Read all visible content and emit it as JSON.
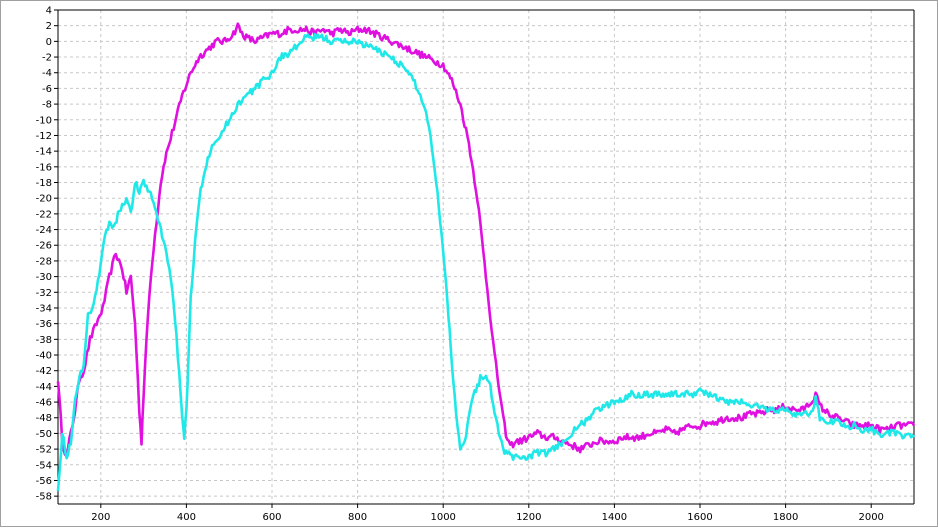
{
  "chart_data": {
    "type": "line",
    "title": "",
    "xlabel": "",
    "ylabel": "",
    "xlim": [
      100,
      2100
    ],
    "ylim": [
      -59,
      4
    ],
    "grid": true,
    "legend": "none",
    "x_ticks": [
      200,
      400,
      600,
      800,
      1000,
      1200,
      1400,
      1600,
      1800,
      2000
    ],
    "y_ticks": [
      4,
      2,
      0,
      -2,
      -4,
      -6,
      -8,
      -10,
      -12,
      -14,
      -16,
      -18,
      -20,
      -22,
      -24,
      -26,
      -28,
      -30,
      -32,
      -34,
      -36,
      -38,
      -40,
      -42,
      -44,
      -46,
      -48,
      -50,
      -52,
      -54,
      -56,
      -58
    ],
    "series": [
      {
        "color": "#e010e0",
        "x": [
          100,
          110,
          120,
          130,
          140,
          150,
          160,
          175,
          190,
          205,
          220,
          235,
          250,
          260,
          270,
          280,
          290,
          295,
          300,
          310,
          320,
          330,
          340,
          350,
          370,
          390,
          410,
          430,
          450,
          470,
          490,
          510,
          520,
          530,
          540,
          560,
          580,
          600,
          620,
          640,
          660,
          680,
          700,
          720,
          740,
          760,
          780,
          800,
          820,
          840,
          860,
          880,
          900,
          920,
          940,
          960,
          980,
          1000,
          1020,
          1040,
          1060,
          1080,
          1100,
          1120,
          1140,
          1150,
          1160,
          1170,
          1180,
          1200,
          1220,
          1240,
          1260,
          1280,
          1300,
          1320,
          1340,
          1360,
          1380,
          1400,
          1420,
          1440,
          1460,
          1480,
          1500,
          1520,
          1540,
          1560,
          1580,
          1600,
          1620,
          1640,
          1660,
          1680,
          1700,
          1720,
          1740,
          1760,
          1780,
          1800,
          1820,
          1840,
          1860,
          1870,
          1880,
          1900,
          1920,
          1940,
          1960,
          1980,
          2000,
          2020,
          2040,
          2060,
          2080,
          2100
        ],
        "values": [
          -43,
          -51,
          -53,
          -50,
          -47,
          -43,
          -42,
          -38,
          -36,
          -34,
          -30,
          -27,
          -29,
          -32,
          -30,
          -36,
          -47,
          -51,
          -45,
          -35,
          -28,
          -23,
          -18,
          -15,
          -11,
          -7,
          -4,
          -2,
          -1,
          0,
          0,
          1,
          2,
          1,
          0.5,
          0,
          0.5,
          1,
          1,
          1.5,
          1.5,
          1.5,
          1,
          1.5,
          1,
          1.5,
          1,
          1.5,
          1.5,
          1,
          0.5,
          0,
          -0.5,
          -1,
          -1.5,
          -2,
          -2.5,
          -3,
          -5,
          -8,
          -13,
          -20,
          -30,
          -40,
          -48,
          -51,
          -51.5,
          -51,
          -51,
          -50.5,
          -50,
          -50.5,
          -50.5,
          -51,
          -51.5,
          -52,
          -51.5,
          -51,
          -51,
          -51,
          -50.5,
          -50.5,
          -50.5,
          -50,
          -50,
          -49.5,
          -50,
          -49.5,
          -49,
          -49,
          -48.5,
          -48.5,
          -48,
          -48,
          -48,
          -47.5,
          -47.5,
          -47,
          -47,
          -46.5,
          -47,
          -47,
          -46,
          -45,
          -46.5,
          -47.5,
          -48,
          -48.5,
          -49,
          -49,
          -49,
          -49.5,
          -49.5,
          -49,
          -49,
          -49
        ]
      },
      {
        "color": "#20e8e8",
        "x": [
          100,
          110,
          120,
          130,
          140,
          150,
          160,
          170,
          180,
          190,
          200,
          210,
          220,
          230,
          240,
          250,
          260,
          270,
          280,
          290,
          300,
          310,
          320,
          330,
          340,
          350,
          360,
          370,
          380,
          390,
          395,
          400,
          405,
          410,
          420,
          430,
          440,
          450,
          460,
          480,
          500,
          520,
          540,
          560,
          580,
          600,
          620,
          640,
          660,
          680,
          700,
          720,
          740,
          760,
          780,
          800,
          820,
          840,
          860,
          880,
          900,
          920,
          940,
          960,
          970,
          980,
          990,
          1000,
          1010,
          1015,
          1020,
          1030,
          1040,
          1050,
          1060,
          1070,
          1080,
          1090,
          1100,
          1110,
          1120,
          1130,
          1140,
          1160,
          1180,
          1200,
          1220,
          1240,
          1260,
          1280,
          1300,
          1320,
          1340,
          1360,
          1380,
          1400,
          1420,
          1440,
          1460,
          1480,
          1500,
          1520,
          1540,
          1560,
          1580,
          1600,
          1620,
          1640,
          1660,
          1680,
          1700,
          1720,
          1740,
          1760,
          1780,
          1800,
          1820,
          1840,
          1860,
          1870,
          1880,
          1900,
          1920,
          1940,
          1960,
          1980,
          2000,
          2020,
          2040,
          2060,
          2080,
          2100
        ],
        "values": [
          -57,
          -50,
          -53,
          -51,
          -46,
          -43,
          -41,
          -35,
          -34,
          -32,
          -28,
          -25,
          -23,
          -24,
          -22,
          -21,
          -20,
          -22,
          -18,
          -19,
          -18,
          -19,
          -20,
          -22,
          -24,
          -26,
          -29,
          -33,
          -40,
          -48,
          -51,
          -47,
          -40,
          -33,
          -26,
          -20,
          -17,
          -15,
          -13,
          -12,
          -10,
          -8,
          -7,
          -6,
          -5,
          -4,
          -2,
          -1.5,
          -0.5,
          0.5,
          0.5,
          0.5,
          0,
          0,
          0,
          0,
          -0.5,
          -1,
          -1.5,
          -2,
          -3,
          -4,
          -6,
          -9,
          -12,
          -16,
          -21,
          -27,
          -33,
          -37,
          -41,
          -47,
          -52,
          -51,
          -48,
          -45,
          -44,
          -42.5,
          -43,
          -44,
          -47,
          -50,
          -52,
          -53,
          -53,
          -53,
          -52.5,
          -52.5,
          -52,
          -51,
          -50,
          -49,
          -48,
          -47,
          -46.5,
          -46,
          -45.5,
          -45,
          -45,
          -45,
          -45,
          -45,
          -45,
          -45,
          -45,
          -44.5,
          -45,
          -45.5,
          -46,
          -46,
          -46,
          -46.5,
          -46.5,
          -47,
          -47,
          -47,
          -47.5,
          -47.5,
          -47.5,
          -45.5,
          -48,
          -48.5,
          -48.5,
          -49,
          -49,
          -49.5,
          -49.5,
          -50,
          -50,
          -50,
          -50.5,
          -50.5
        ]
      }
    ]
  }
}
